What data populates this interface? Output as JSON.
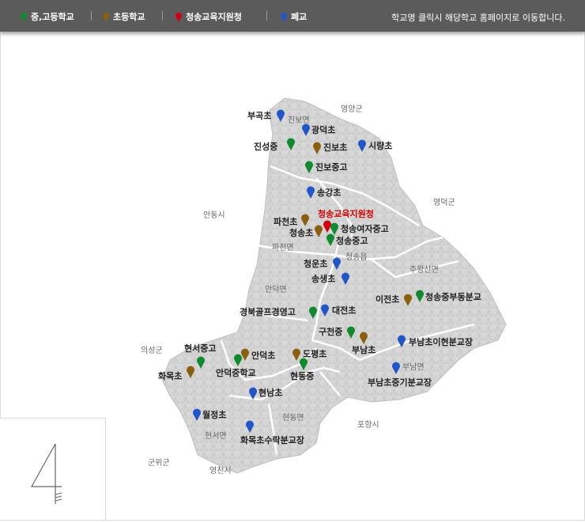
{
  "legend": {
    "items": [
      {
        "label": "중,고등학교",
        "color": "#0f8a2f"
      },
      {
        "label": "초등학교",
        "color": "#8a6010"
      },
      {
        "label": "청송교육지원청",
        "color": "#d40010"
      },
      {
        "label": "폐교",
        "color": "#2255c8"
      }
    ],
    "note": "학교명 클릭시 해당학교 홈페이지로 이동합니다."
  },
  "regions": {
    "yeongyang": "영양군",
    "andong": "안동시",
    "yeongdeok": "영덕군",
    "uiseong": "의성군",
    "pohang": "포항시",
    "gunwi": "군위군",
    "yeongcheon": "영천시"
  },
  "districts": {
    "jinbo": "진보면",
    "parcheon": "파천면",
    "cheongsong": "청송읍",
    "jucwang": "주왕산면",
    "andeok": "안덕면",
    "bunam": "부남면",
    "hyeondong": "현동면",
    "hyeonseo": "현서면"
  },
  "office": {
    "label": "청송교육지원청"
  },
  "schools": {
    "bugok": "부곡초",
    "gwangdeok": "광덕초",
    "jinseong": "진성중",
    "jinbo_elem": "진보초",
    "sirang": "시량초",
    "jinbo_middle": "진보중고",
    "songgang": "송강초",
    "parcheon": "파천초",
    "cheongsong_elem": "청송초",
    "cheongsong_girls": "청송여자중고",
    "cheongsong_middle": "청송중고",
    "cheongun": "청운초",
    "songsaeng": "송생초",
    "ijeon": "이전초",
    "cheongsong_bunggyo": "청송중부동분교",
    "golf": "경북골프경영고",
    "daejeon": "대전초",
    "gucheon": "구천중",
    "bunam": "부남초",
    "bunam_ihyeon": "부남초이현분교장",
    "hyeonseo_middle": "현서중고",
    "andeok_elem": "안덕초",
    "dopyeong": "도평초",
    "andeok_middle": "안덕중학교",
    "hyeondong": "현동중",
    "hwamok": "화목초",
    "bunam_junggi": "부남초중기분교장",
    "hyeonnam": "현남초",
    "woljeong": "월정초",
    "hwamok_surak": "화목초수락분교장"
  }
}
